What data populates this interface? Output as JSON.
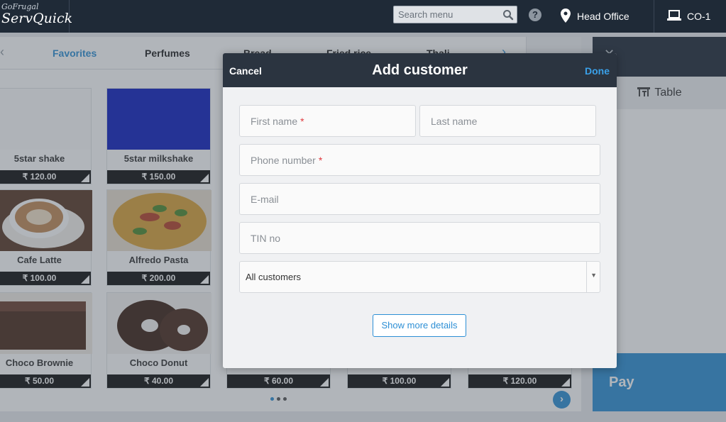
{
  "header": {
    "brand": "GoFrugal",
    "product": "ServQuick",
    "search_placeholder": "Search menu",
    "help_label": "?",
    "location": "Head Office",
    "counter": "CO-1"
  },
  "catalog": {
    "tabs": [
      {
        "label": "Favorites",
        "active": true
      },
      {
        "label": "Perfumes",
        "active": false
      },
      {
        "label": "Bread",
        "active": false
      },
      {
        "label": "Fried rice",
        "active": false
      },
      {
        "label": "Thali",
        "active": false
      }
    ],
    "items": [
      {
        "name": "5star shake",
        "price": "₹ 120.00"
      },
      {
        "name": "5star milkshake",
        "price": "₹ 150.00",
        "color": "#0f1fbf"
      },
      {
        "name": "Cafe Latte",
        "price": "₹ 100.00"
      },
      {
        "name": "Alfredo Pasta",
        "price": "₹ 200.00"
      },
      {
        "name": "Choco Brownie",
        "price": "₹ 50.00"
      },
      {
        "name": "Choco Donut",
        "price": "₹ 40.00"
      },
      {
        "name": "",
        "price": "₹ 60.00"
      },
      {
        "name": "",
        "price": "₹ 100.00"
      },
      {
        "name": "",
        "price": "₹ 120.00"
      }
    ],
    "next_label": "›"
  },
  "right_panel": {
    "table_label": "Table",
    "pay_label": "Pay"
  },
  "modal": {
    "title": "Add customer",
    "cancel_label": "Cancel",
    "done_label": "Done",
    "fields": {
      "first_name": "First name",
      "last_name": "Last name",
      "phone": "Phone number",
      "email": "E-mail",
      "tin": "TIN no"
    },
    "required_mark": "*",
    "customer_group": "All customers",
    "more_label": "Show more details"
  },
  "colors": {
    "accent": "#2d8fd5",
    "header_bg": "#1f2a37",
    "required": "#e0393e"
  }
}
